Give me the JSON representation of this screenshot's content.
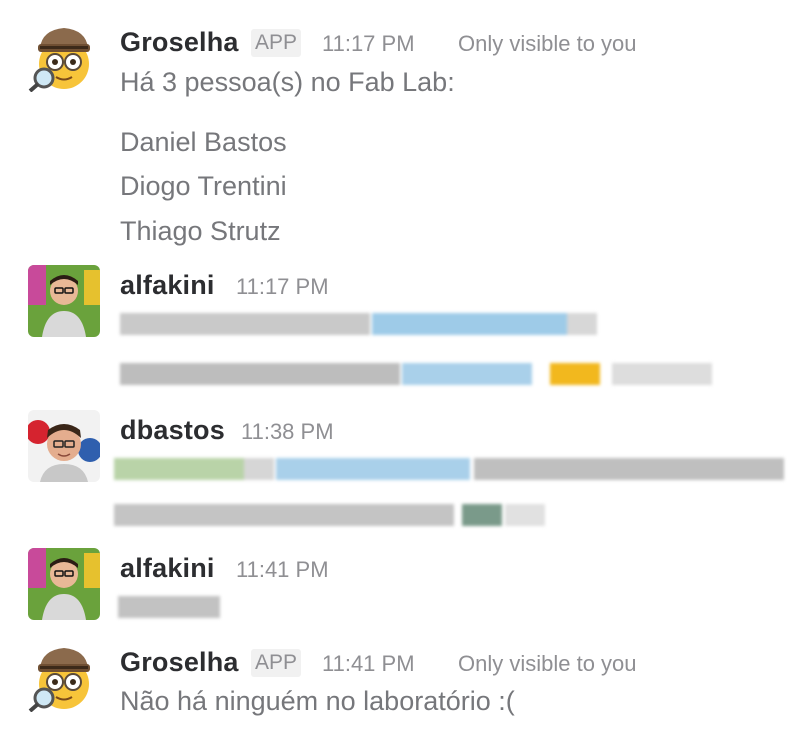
{
  "messages": [
    {
      "sender": "Groselha",
      "app_tag": "APP",
      "time": "11:17 PM",
      "visibility": "Only visible to you",
      "text": "Há 3 pessoa(s) no Fab Lab:",
      "people": [
        "Daniel Bastos",
        "Diogo Trentini",
        "Thiago Strutz"
      ],
      "avatar_icon": "detective-emoji-icon"
    },
    {
      "sender": "alfakini",
      "time": "11:17 PM",
      "avatar_icon": "user-photo-avatar"
    },
    {
      "sender": "dbastos",
      "time": "11:38 PM",
      "avatar_icon": "user-photo-avatar"
    },
    {
      "sender": "alfakini",
      "time": "11:41 PM",
      "avatar_icon": "user-photo-avatar"
    },
    {
      "sender": "Groselha",
      "app_tag": "APP",
      "time": "11:41 PM",
      "visibility": "Only visible to you",
      "text": "Não há ninguém no laboratório :(",
      "avatar_icon": "detective-emoji-icon"
    }
  ],
  "colors": {
    "name": "#2c2d30",
    "meta": "#8f8f93",
    "body_text": "#76777b",
    "link_blur": "#9ecbe8",
    "highlight_blur": "#f2b81e"
  }
}
